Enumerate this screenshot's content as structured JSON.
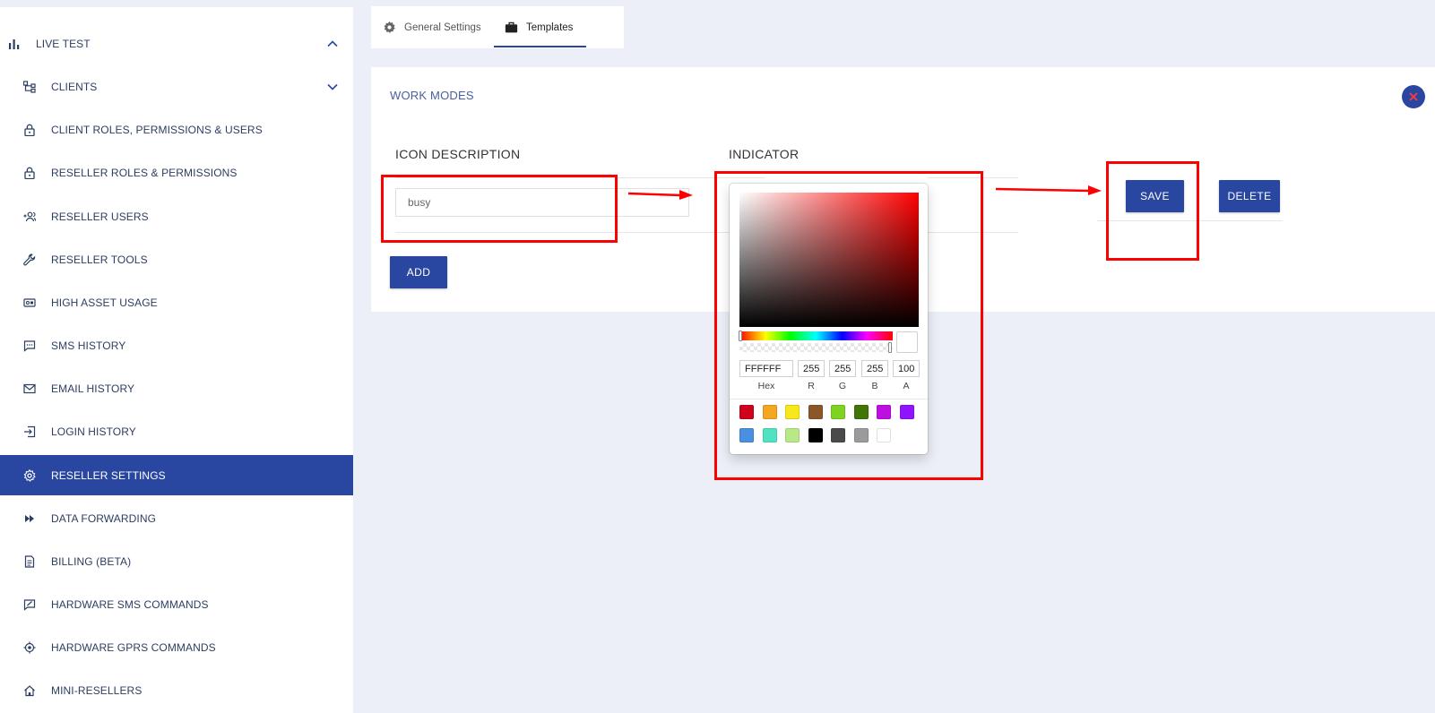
{
  "sidebar": {
    "items": [
      {
        "label": "LIVE TEST",
        "icon": "bar-chart-icon"
      },
      {
        "label": "CLIENTS",
        "icon": "hierarchy-icon"
      },
      {
        "label": "CLIENT ROLES, PERMISSIONS & USERS",
        "icon": "lock-icon"
      },
      {
        "label": "RESELLER ROLES & PERMISSIONS",
        "icon": "lock-icon"
      },
      {
        "label": "RESELLER USERS",
        "icon": "add-users-icon"
      },
      {
        "label": "RESELLER TOOLS",
        "icon": "wrench-icon"
      },
      {
        "label": "HIGH ASSET USAGE",
        "icon": "asset-usage-icon"
      },
      {
        "label": "SMS HISTORY",
        "icon": "chat-icon"
      },
      {
        "label": "EMAIL HISTORY",
        "icon": "envelope-icon"
      },
      {
        "label": "LOGIN HISTORY",
        "icon": "login-icon"
      },
      {
        "label": "RESELLER SETTINGS",
        "icon": "gear-icon"
      },
      {
        "label": "DATA FORWARDING",
        "icon": "fast-forward-icon"
      },
      {
        "label": "BILLING (BETA)",
        "icon": "document-icon"
      },
      {
        "label": "HARDWARE SMS COMMANDS",
        "icon": "message-edit-icon"
      },
      {
        "label": "HARDWARE GPRS COMMANDS",
        "icon": "target-icon"
      },
      {
        "label": "MINI-RESELLERS",
        "icon": "home-icon"
      }
    ]
  },
  "tabs": [
    {
      "label": "General Settings",
      "icon": "gear-icon"
    },
    {
      "label": "Templates",
      "icon": "briefcase-icon"
    }
  ],
  "card": {
    "title": "WORK MODES",
    "columns": {
      "icon_description": "ICON DESCRIPTION",
      "indicator": "INDICATOR"
    },
    "row": {
      "description_value": "busy"
    },
    "save_label": "SAVE",
    "delete_label": "DELETE",
    "add_label": "ADD"
  },
  "picker": {
    "hex": "FFFFFF",
    "r": "255",
    "g": "255",
    "b": "255",
    "a": "100",
    "labels": {
      "hex": "Hex",
      "r": "R",
      "g": "G",
      "b": "B",
      "a": "A"
    },
    "preset_colors": [
      "#D0021B",
      "#F5A623",
      "#F8E71C",
      "#8B572A",
      "#7ED321",
      "#417505",
      "#BD10E0",
      "#9013FE",
      "#4A90E2",
      "#50E3C2",
      "#B8E986",
      "#000000",
      "#4A4A4A",
      "#9B9B9B",
      "#FFFFFF"
    ]
  },
  "colors": {
    "accent": "#2946A0",
    "annotation": "#FF0000",
    "background": "#ECEFF7"
  }
}
